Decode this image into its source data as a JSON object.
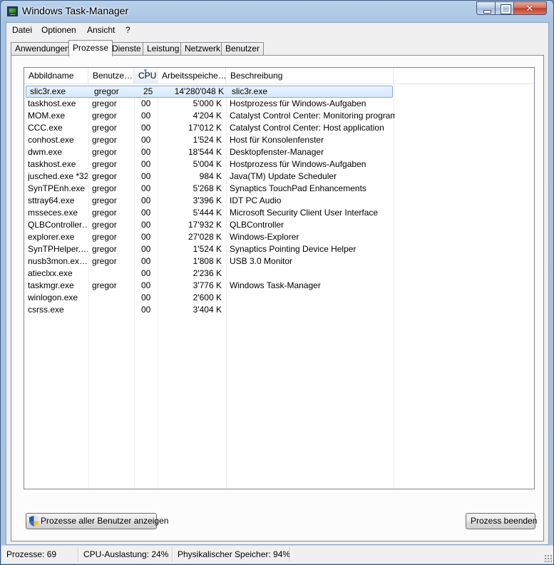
{
  "window": {
    "title": "Windows Task-Manager",
    "close_glyph": "✕"
  },
  "menu": [
    "Datei",
    "Optionen",
    "Ansicht",
    "?"
  ],
  "tabs": [
    "Anwendungen",
    "Prozesse",
    "Dienste",
    "Leistung",
    "Netzwerk",
    "Benutzer"
  ],
  "active_tab": "Prozesse",
  "columns": [
    "Abbildname",
    "Benutze…",
    "CPU",
    "Arbeitsspeiche…",
    "Beschreibung"
  ],
  "sorted_column": "CPU",
  "processes": [
    {
      "name": "slic3r.exe",
      "user": "gregor",
      "cpu": "25",
      "mem": "14'280'048 K",
      "desc": "slic3r.exe",
      "selected": true
    },
    {
      "name": "taskhost.exe",
      "user": "gregor",
      "cpu": "00",
      "mem": "5'000 K",
      "desc": "Hostprozess für Windows-Aufgaben"
    },
    {
      "name": "MOM.exe",
      "user": "gregor",
      "cpu": "00",
      "mem": "4'204 K",
      "desc": "Catalyst Control Center: Monitoring program"
    },
    {
      "name": "CCC.exe",
      "user": "gregor",
      "cpu": "00",
      "mem": "17'012 K",
      "desc": "Catalyst Control Center: Host application"
    },
    {
      "name": "conhost.exe",
      "user": "gregor",
      "cpu": "00",
      "mem": "1'524 K",
      "desc": "Host für Konsolenfenster"
    },
    {
      "name": "dwm.exe",
      "user": "gregor",
      "cpu": "00",
      "mem": "18'544 K",
      "desc": "Desktopfenster-Manager"
    },
    {
      "name": "taskhost.exe",
      "user": "gregor",
      "cpu": "00",
      "mem": "5'004 K",
      "desc": "Hostprozess für Windows-Aufgaben"
    },
    {
      "name": "jusched.exe *32",
      "user": "gregor",
      "cpu": "00",
      "mem": "984 K",
      "desc": "Java(TM) Update Scheduler"
    },
    {
      "name": "SynTPEnh.exe",
      "user": "gregor",
      "cpu": "00",
      "mem": "5'268 K",
      "desc": "Synaptics TouchPad Enhancements"
    },
    {
      "name": "sttray64.exe",
      "user": "gregor",
      "cpu": "00",
      "mem": "3'396 K",
      "desc": "IDT PC Audio"
    },
    {
      "name": "msseces.exe",
      "user": "gregor",
      "cpu": "00",
      "mem": "5'444 K",
      "desc": "Microsoft Security Client User Interface"
    },
    {
      "name": "QLBController…",
      "user": "gregor",
      "cpu": "00",
      "mem": "17'932 K",
      "desc": "QLBController"
    },
    {
      "name": "explorer.exe",
      "user": "gregor",
      "cpu": "00",
      "mem": "27'028 K",
      "desc": "Windows-Explorer"
    },
    {
      "name": "SynTPHelper.…",
      "user": "gregor",
      "cpu": "00",
      "mem": "1'524 K",
      "desc": "Synaptics Pointing Device Helper"
    },
    {
      "name": "nusb3mon.ex…",
      "user": "gregor",
      "cpu": "00",
      "mem": "1'808 K",
      "desc": "USB 3.0 Monitor"
    },
    {
      "name": "atieclxx.exe",
      "user": "",
      "cpu": "00",
      "mem": "2'236 K",
      "desc": ""
    },
    {
      "name": "taskmgr.exe",
      "user": "gregor",
      "cpu": "00",
      "mem": "3'776 K",
      "desc": "Windows Task-Manager"
    },
    {
      "name": "winlogon.exe",
      "user": "",
      "cpu": "00",
      "mem": "2'600 K",
      "desc": ""
    },
    {
      "name": "csrss.exe",
      "user": "",
      "cpu": "00",
      "mem": "3'404 K",
      "desc": ""
    }
  ],
  "buttons": {
    "show_all": "Prozesse aller Benutzer anzeigen",
    "end_process": "Prozess beenden"
  },
  "status": {
    "processes": "Prozesse: 69",
    "cpu": "CPU-Auslastung: 24%",
    "memory": "Physikalischer Speicher: 94%"
  }
}
